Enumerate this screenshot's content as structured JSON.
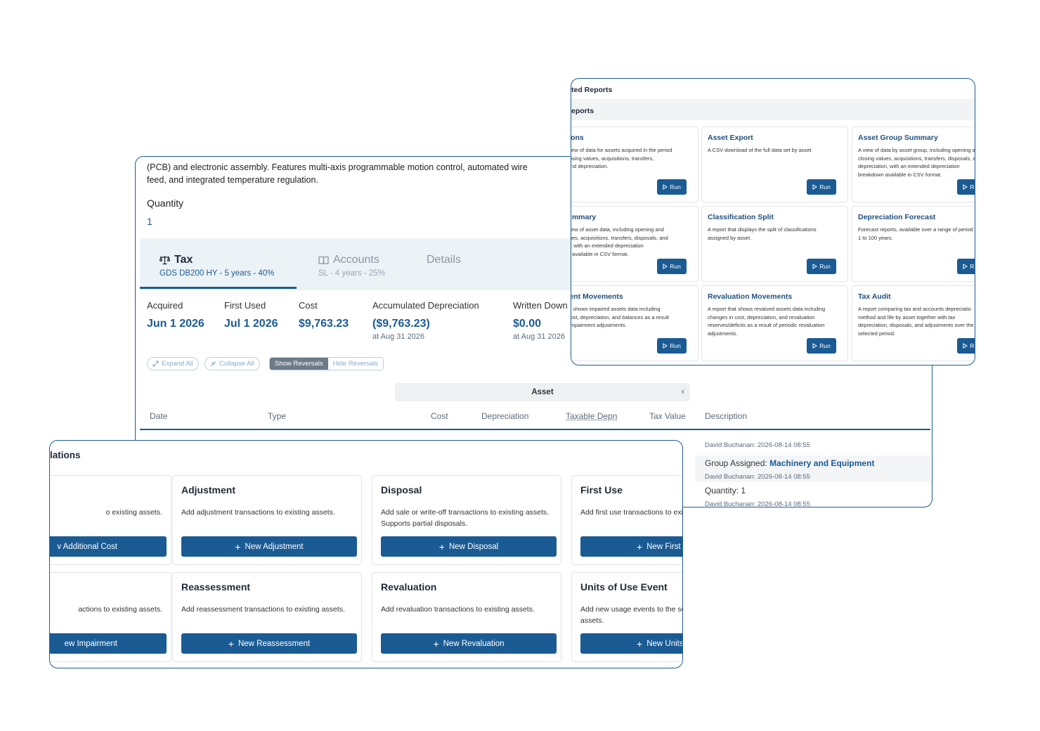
{
  "asset_panel": {
    "description": "(PCB) and electronic assembly. Features multi-axis programmable motion control, automated wire feed, and integrated temperature regulation.",
    "quantity_label": "Quantity",
    "quantity_value": "1",
    "tabs": [
      {
        "label": "Tax",
        "sub": "GDS DB200 HY - 5 years - 40%",
        "icon": "balance-scale-icon",
        "active": true
      },
      {
        "label": "Accounts",
        "sub": "SL - 4 years - 25%",
        "icon": "book-icon",
        "active": false
      },
      {
        "label": "Details",
        "sub": "",
        "active": false
      }
    ],
    "summary": [
      {
        "label": "Acquired",
        "value": "Jun 1 2026",
        "sub": ""
      },
      {
        "label": "First Used",
        "value": "Jul 1 2026",
        "sub": ""
      },
      {
        "label": "Cost",
        "value": "$9,763.23",
        "sub": ""
      },
      {
        "label": "Accumulated Depreciation",
        "value": "($9,763.23)",
        "sub": "at Aug 31 2026"
      },
      {
        "label": "Written Down",
        "value": "$0.00",
        "sub": "at Aug 31 2026"
      }
    ],
    "controls": {
      "expand_all": "Expand All",
      "collapse_all": "Collapse All",
      "show_reversals": "Show Reversals",
      "hide_reversals": "Hide Reversals"
    },
    "asset_group_header": "Asset",
    "columns": [
      "Date",
      "Type",
      "Cost",
      "Depreciation",
      "Taxable Depn",
      "Tax Value",
      "Description"
    ],
    "history": {
      "meta_1": "David Buchanan: 2026-08-14 08:55",
      "group_label": "Group Assigned:",
      "group_value": "Machinery and Equipment",
      "meta_2": "David Buchanan: 2026-08-14 08:55",
      "quantity_line": "Quantity: 1",
      "meta_3": "David Buchanan: 2026-08-14 08:55"
    }
  },
  "reports_panel": {
    "title": "ted Reports",
    "section": "eports",
    "run_label": "Run",
    "cards": [
      {
        "title": "isitions",
        "desc": "iled view of data for assets acquired in the period\nng closing values, acquisitions, transfers,\nals, and depreciation."
      },
      {
        "title": "Asset Export",
        "desc": "A CSV download of the full data set by asset"
      },
      {
        "title": "Asset Group Summary",
        "desc": "A view of data by asset group, including opening a\nclosing values, acquisitions, transfers, disposals, a\ndepreciation, with an extended depreciation\nbreakdown available in CSV format."
      },
      {
        "title": "t Summary",
        "desc": "iled view of asset data, including opening and\ng values, acquisitions, transfers, disposals, and\niation, with an extended depreciation\ndown available in CSV format."
      },
      {
        "title": "Classification Split",
        "desc": "A report that displays the split of classifications\nassigned by asset."
      },
      {
        "title": "Depreciation Forecast",
        "desc": "Forecast reports, available over a range of period\n1 to 100 years."
      },
      {
        "title": "irment Movements",
        "desc": "rt that shows impaired assets data including\ns in cost, depreciation, and balances as a result\nodic impairment adjustments."
      },
      {
        "title": "Revaluation Movements",
        "desc": "A report that shows revalued assets data including\nchanges in cost, depreciation, and revaluation\nreserves/deficits as a result of periodic revaluation\nadjustments."
      },
      {
        "title": "Tax Audit",
        "desc": "A report comparing tax and accounts depreciatio\nmethod and life by asset together with tax\ndepreciation, disposals, and adjustments over the\nselected period."
      }
    ]
  },
  "transactions_panel": {
    "title": "lations",
    "cards": [
      {
        "title": "",
        "desc": "o existing assets.",
        "button": "v Additional Cost",
        "plus": false
      },
      {
        "title": "Adjustment",
        "desc": "Add adjustment transactions to existing assets.",
        "button": "New Adjustment",
        "plus": true
      },
      {
        "title": "Disposal",
        "desc": "Add sale or write-off transactions to existing assets.\nSupports partial disposals.",
        "button": "New Disposal",
        "plus": true
      },
      {
        "title": "First Use",
        "desc": "Add first use transactions to exis",
        "button": "New First",
        "plus": true
      },
      {
        "title": "",
        "desc": "actions to existing assets.",
        "button": "ew Impairment",
        "plus": false
      },
      {
        "title": "Reassessment",
        "desc": "Add reassessment transactions to existing assets.",
        "button": "New Reassessment",
        "plus": true
      },
      {
        "title": "Revaluation",
        "desc": "Add revaluation transactions to existing assets.",
        "button": "New Revaluation",
        "plus": true
      },
      {
        "title": "Units of Use Event",
        "desc": "Add new usage events to the sch\nassets.",
        "button": "New Units of U",
        "plus": true
      }
    ]
  },
  "colors": {
    "accent": "#1b5b94",
    "border": "#1b5b94",
    "tab_bg": "#ecf3f7"
  }
}
